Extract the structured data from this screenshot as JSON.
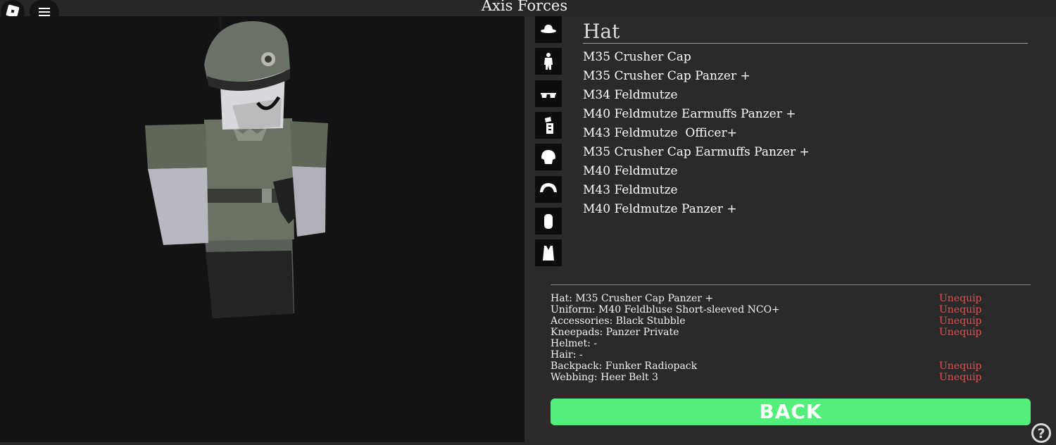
{
  "window": {
    "title": "Axis Forces"
  },
  "topbar": {
    "roblox_icon": "roblox-logo-icon",
    "menu_icon": "hamburger-menu-icon"
  },
  "categories": [
    {
      "icon": "hat-icon"
    },
    {
      "icon": "uniform-icon"
    },
    {
      "icon": "glasses-icon"
    },
    {
      "icon": "kneepads-icon"
    },
    {
      "icon": "helmet-icon"
    },
    {
      "icon": "hair-icon"
    },
    {
      "icon": "backpack-icon"
    },
    {
      "icon": "vest-icon"
    }
  ],
  "list": {
    "title": "Hat",
    "items": [
      "M35 Crusher Cap",
      "M35 Crusher Cap Panzer +",
      "M34 Feldmutze",
      "M40 Feldmutze Earmuffs Panzer +",
      "M43 Feldmutze  Officer+",
      "M35 Crusher Cap Earmuffs Panzer +",
      "M40 Feldmutze",
      "M43 Feldmutze",
      "M40 Feldmutze Panzer +"
    ]
  },
  "summary": [
    {
      "label": "Hat: M35 Crusher Cap Panzer +",
      "action": "Unequip"
    },
    {
      "label": "Uniform: M40 Feldbluse Short-sleeved NCO+",
      "action": "Unequip"
    },
    {
      "label": "Accessories: Black Stubble",
      "action": "Unequip"
    },
    {
      "label": "Kneepads: Panzer Private",
      "action": "Unequip"
    },
    {
      "label": "Helmet: -",
      "action": ""
    },
    {
      "label": "Hair: -",
      "action": ""
    },
    {
      "label": "Backpack: Funker Radiopack",
      "action": "Unequip"
    },
    {
      "label": "Webbing: Heer Belt 3",
      "action": "Unequip"
    }
  ],
  "back_label": "BACK",
  "help_label": "?",
  "colors": {
    "accent_green": "#52f07a",
    "unequip_red": "#e0524f"
  }
}
